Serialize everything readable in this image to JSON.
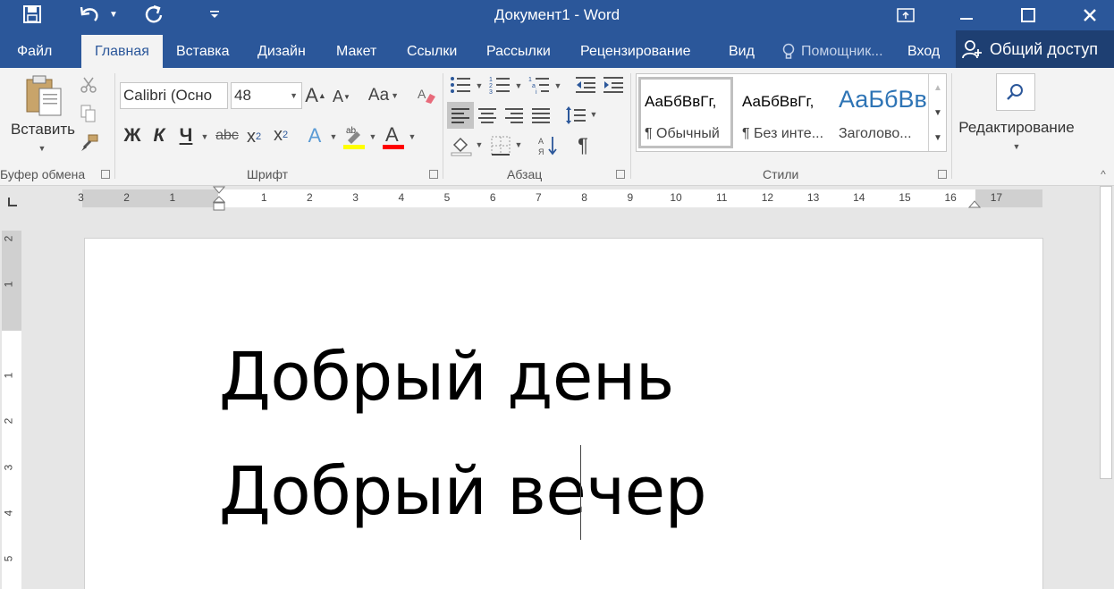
{
  "window": {
    "title": "Документ1 - Word"
  },
  "quick_access": {
    "icons": [
      "save-icon",
      "undo-icon",
      "redo-icon",
      "customize-icon"
    ]
  },
  "tabs": [
    {
      "label": "Файл"
    },
    {
      "label": "Главная",
      "active": true
    },
    {
      "label": "Вставка"
    },
    {
      "label": "Дизайн"
    },
    {
      "label": "Макет"
    },
    {
      "label": "Ссылки"
    },
    {
      "label": "Рассылки"
    },
    {
      "label": "Рецензирование"
    },
    {
      "label": "Вид"
    }
  ],
  "tell_me": "Помощник...",
  "signin": "Вход",
  "share": "Общий доступ",
  "ribbon": {
    "clipboard": {
      "paste_label": "Вставить",
      "group_label": "Буфер обмена"
    },
    "font": {
      "name": "Calibri (Осно",
      "size": "48",
      "bold": "Ж",
      "italic": "К",
      "underline": "Ч",
      "strike": "abc",
      "group_label": "Шрифт"
    },
    "paragraph": {
      "group_label": "Абзац"
    },
    "styles": {
      "items": [
        {
          "preview": "АаБбВвГг,",
          "name": "¶ Обычный"
        },
        {
          "preview": "АаБбВвГг,",
          "name": "¶ Без инте..."
        },
        {
          "preview": "АаБбВв",
          "name": "Заголово..."
        }
      ],
      "group_label": "Стили"
    },
    "editing": {
      "label": "Редактирование"
    }
  },
  "ruler": {
    "labels": [
      "3",
      "2",
      "1",
      "1",
      "2",
      "3",
      "4",
      "5",
      "6",
      "7",
      "8",
      "9",
      "10",
      "11",
      "12",
      "13",
      "14",
      "15",
      "16",
      "17"
    ],
    "vertical_labels": [
      "2",
      "1",
      "1",
      "2",
      "3",
      "4",
      "5"
    ]
  },
  "document": {
    "lines": [
      "Добрый день",
      "Добрый вечер"
    ]
  },
  "colors": {
    "brand": "#2b579a",
    "ribbon": "#f3f3f3",
    "highlight": "#ffff00",
    "font_color": "#ff0000"
  }
}
